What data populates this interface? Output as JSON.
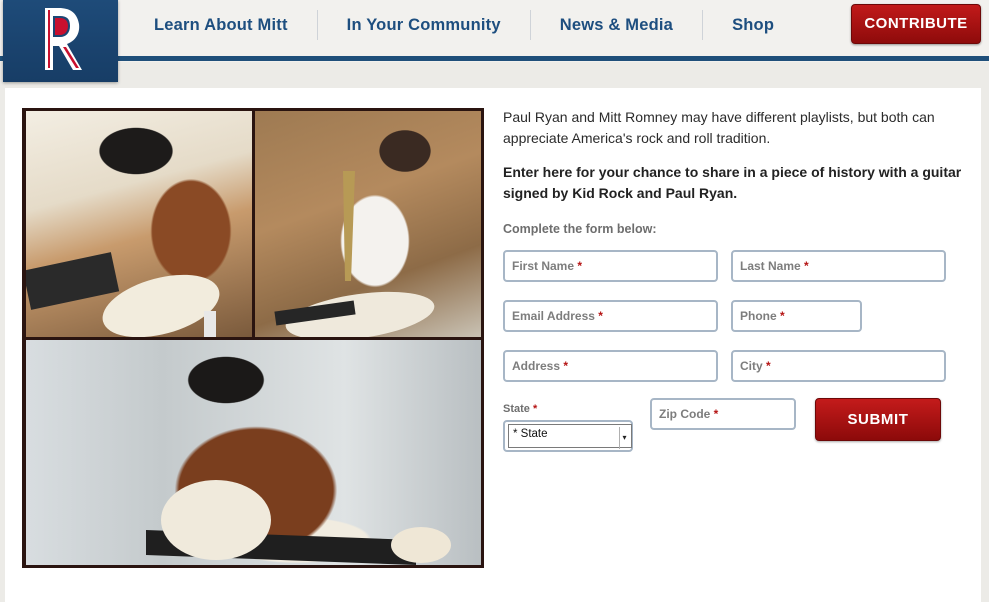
{
  "colors": {
    "brand_blue": "#1d4e7f",
    "brand_red": "#b51414",
    "field_border": "#a7b6c6"
  },
  "logo": {
    "icon": "romney-r-logo"
  },
  "nav": {
    "items": [
      {
        "label": "Learn About Mitt"
      },
      {
        "label": "In Your Community"
      },
      {
        "label": "News & Media"
      },
      {
        "label": "Shop"
      }
    ],
    "contribute_label": "CONTRIBUTE"
  },
  "content": {
    "intro": "Paul Ryan and Mitt Romney may have different playlists, but both can appreciate America's rock and roll tradition.",
    "callout": "Enter here for your chance to share in a piece of history with a guitar signed by Kid Rock and Paul Ryan."
  },
  "form": {
    "title": "Complete the form below:",
    "first_name": "First Name",
    "last_name": "Last Name",
    "email": "Email Address",
    "phone": "Phone",
    "address": "Address",
    "city": "City",
    "state_label": "State",
    "state_value": "* State",
    "zip": "Zip Code",
    "required_mark": "*",
    "submit_label": "SUBMIT"
  }
}
